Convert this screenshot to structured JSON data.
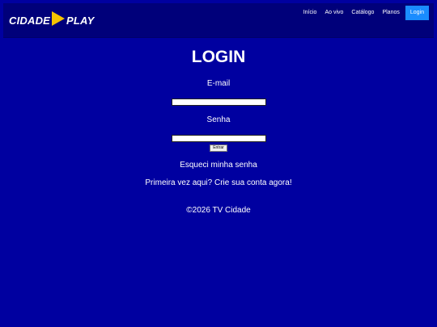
{
  "brand": {
    "word1": "CIDADE",
    "word2": "PLAY",
    "accent": "#f5c400"
  },
  "nav": {
    "items": [
      {
        "label": "Início"
      },
      {
        "label": "Ao vivo"
      },
      {
        "label": "Catálogo"
      },
      {
        "label": "Planos"
      },
      {
        "label": "Login"
      }
    ],
    "active_color": "#1a8cff"
  },
  "login": {
    "title": "LOGIN",
    "email_label": "E-mail",
    "email_value": "",
    "password_label": "Senha",
    "password_value": "",
    "submit_label": "Entrar",
    "forgot_link": "Esqueci minha senha",
    "signup_link": "Primeira vez aqui? Crie sua conta agora!"
  },
  "footer": {
    "copyright": "©2026 TV Cidade"
  },
  "colors": {
    "page_bg": "#0000a0",
    "navbar_bg": "#00007a",
    "text": "#ffffff"
  }
}
